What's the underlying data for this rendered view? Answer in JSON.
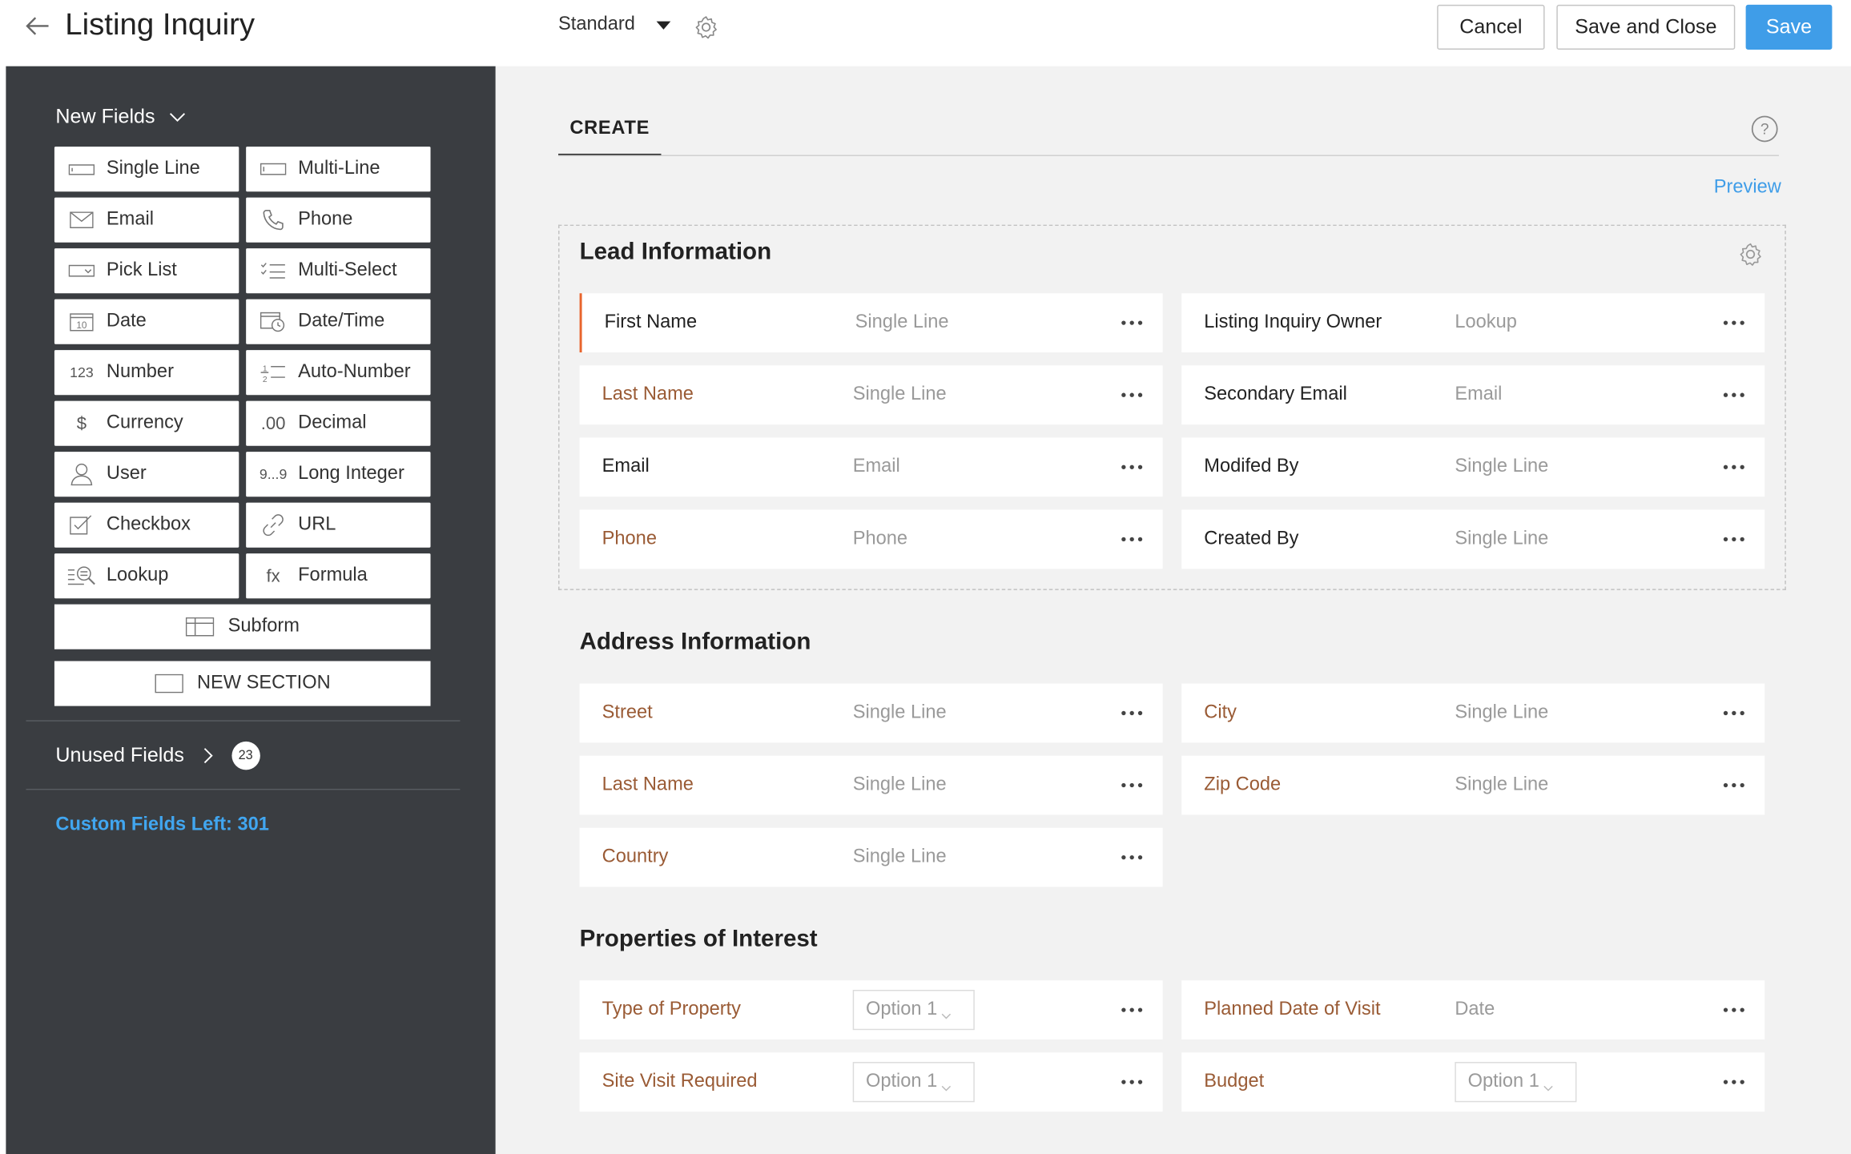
{
  "header": {
    "title": "Listing Inquiry",
    "layout": "Standard",
    "cancel": "Cancel",
    "save_close": "Save and Close",
    "save": "Save"
  },
  "sidebar": {
    "new_fields": "New Fields",
    "fields": [
      {
        "label": "Single Line",
        "icon": "single-line-icon"
      },
      {
        "label": "Multi-Line",
        "icon": "multi-line-icon"
      },
      {
        "label": "Email",
        "icon": "email-icon"
      },
      {
        "label": "Phone",
        "icon": "phone-icon"
      },
      {
        "label": "Pick List",
        "icon": "pick-list-icon"
      },
      {
        "label": "Multi-Select",
        "icon": "multi-select-icon"
      },
      {
        "label": "Date",
        "icon": "date-icon"
      },
      {
        "label": "Date/Time",
        "icon": "date-time-icon"
      },
      {
        "label": "Number",
        "icon": "number-icon",
        "glyph": "123"
      },
      {
        "label": "Auto-Number",
        "icon": "auto-number-icon"
      },
      {
        "label": "Currency",
        "icon": "currency-icon",
        "glyph": "$"
      },
      {
        "label": "Decimal",
        "icon": "decimal-icon",
        "glyph": ".00"
      },
      {
        "label": "User",
        "icon": "user-icon"
      },
      {
        "label": "Long Integer",
        "icon": "long-integer-icon",
        "glyph": "9...9"
      },
      {
        "label": "Checkbox",
        "icon": "checkbox-icon"
      },
      {
        "label": "URL",
        "icon": "url-icon"
      },
      {
        "label": "Lookup",
        "icon": "lookup-icon"
      },
      {
        "label": "Formula",
        "icon": "formula-icon",
        "glyph": "fx"
      }
    ],
    "subform": "Subform",
    "new_section": "NEW SECTION",
    "unused_fields": "Unused Fields",
    "unused_count": "23",
    "custom_fields_left": "Custom Fields Left: 301"
  },
  "main": {
    "tab": "CREATE",
    "preview": "Preview",
    "sections": [
      {
        "title": "Lead Information",
        "fields": [
          {
            "name": "First Name",
            "type": "Single Line",
            "style": "dark",
            "active": true
          },
          {
            "name": "Listing Inquiry Owner",
            "type": "Lookup",
            "style": "dark"
          },
          {
            "name": "Last Name",
            "type": "Single Line",
            "style": "brown"
          },
          {
            "name": "Secondary Email",
            "type": "Email",
            "style": "dark"
          },
          {
            "name": "Email",
            "type": "Email",
            "style": "dark"
          },
          {
            "name": "Modifed By",
            "type": "Single Line",
            "style": "dark"
          },
          {
            "name": "Phone",
            "type": "Phone",
            "style": "brown"
          },
          {
            "name": "Created By",
            "type": "Single Line",
            "style": "dark"
          }
        ]
      },
      {
        "title": "Address Information",
        "fields": [
          {
            "name": "Street",
            "type": "Single Line",
            "style": "brown"
          },
          {
            "name": "City",
            "type": "Single Line",
            "style": "brown"
          },
          {
            "name": "Last Name",
            "type": "Single Line",
            "style": "brown"
          },
          {
            "name": "Zip Code",
            "type": "Single Line",
            "style": "brown"
          },
          {
            "name": "Country",
            "type": "Single Line",
            "style": "brown"
          }
        ]
      },
      {
        "title": "Properties of Interest",
        "fields": [
          {
            "name": "Type of Property",
            "select": "Option 1",
            "style": "brown"
          },
          {
            "name": "Planned Date of Visit",
            "type": "Date",
            "style": "brown"
          },
          {
            "name": "Site Visit Required",
            "select": "Option 1",
            "style": "brown"
          },
          {
            "name": "Budget",
            "select": "Option 1",
            "style": "brown"
          }
        ]
      }
    ]
  },
  "colors": {
    "sidebar_bg": "#3a3d41",
    "accent_blue": "#3f9de8",
    "link_blue": "#41a6f0",
    "field_brown": "#9a5b35",
    "active_orange": "#e8642c"
  }
}
